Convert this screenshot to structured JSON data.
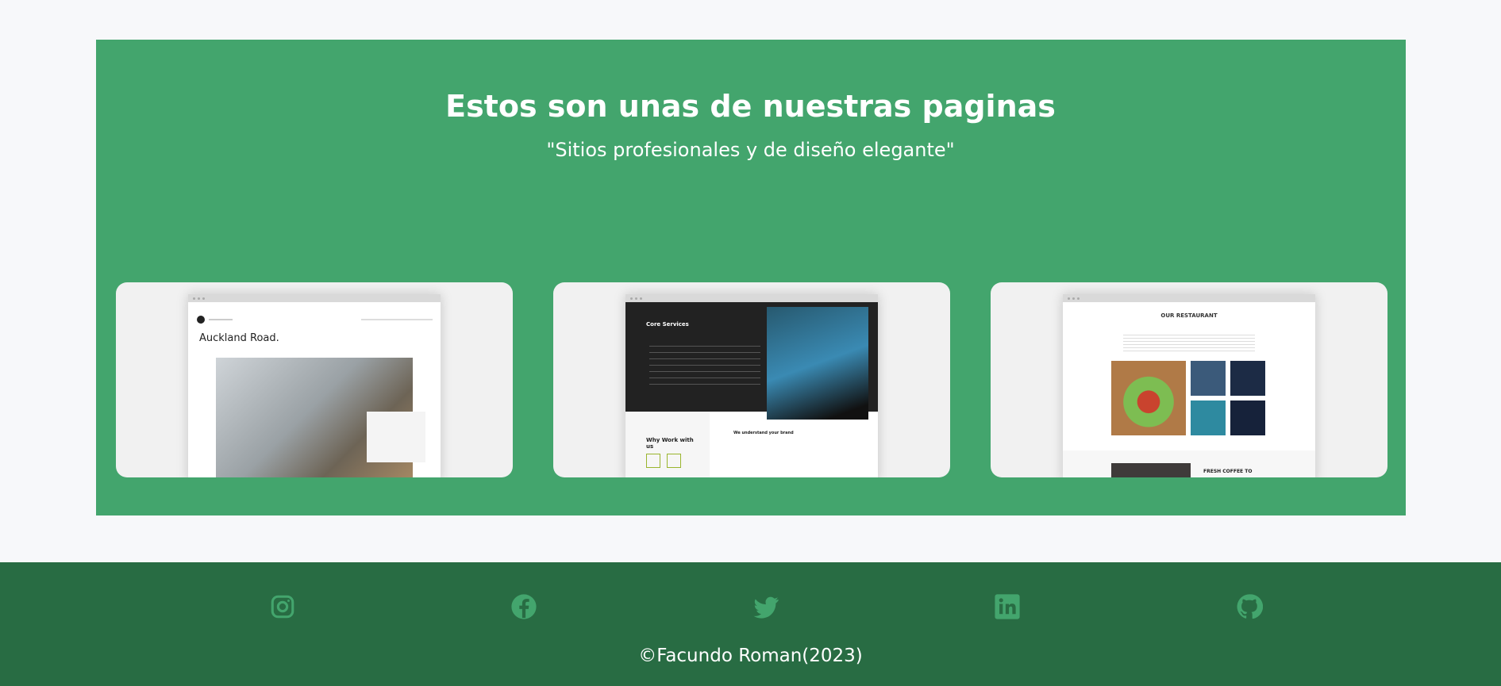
{
  "portfolio": {
    "title": "Estos son unas de nuestras paginas",
    "subtitle": "\"Sitios profesionales y de diseño elegante\"",
    "cards": [
      {
        "heading": "Auckland Road."
      },
      {
        "heading": "Core Services",
        "cta": "Why Work with us",
        "tagline": "We understand your brand"
      },
      {
        "heading": "OUR RESTAURANT",
        "cta": "FRESH COFFEE TO"
      }
    ]
  },
  "footer": {
    "copyright": "©Facundo Roman(2023)",
    "socials": [
      "instagram-icon",
      "facebook-icon",
      "twitter-icon",
      "linkedin-icon",
      "github-icon"
    ]
  },
  "colors": {
    "accent": "#43a56d",
    "footer": "#286c43",
    "background": "#f7f8fa"
  }
}
